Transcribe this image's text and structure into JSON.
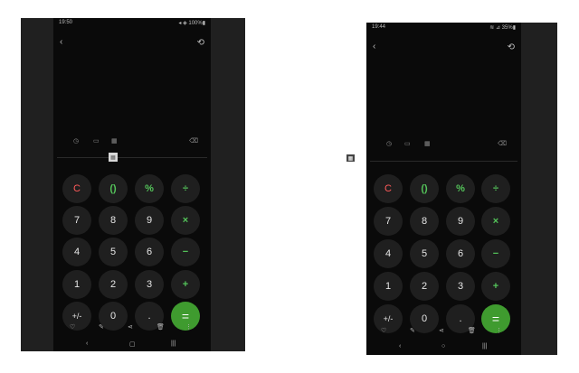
{
  "left_device": {
    "status": {
      "time": "19:50",
      "system": "◂ ◈ 100%▮"
    },
    "toolbar": {
      "back_icon": "‹",
      "rotate_icon": "⟲"
    },
    "tools": {
      "history_icon": "◷",
      "ruler_icon": "▭",
      "calc_icon": "▦",
      "backspace_icon": "⌫"
    },
    "handle_icon": "▦",
    "keys": {
      "clear": "C",
      "parens": "()",
      "percent": "%",
      "divide": "÷",
      "seven": "7",
      "eight": "8",
      "nine": "9",
      "multiply": "×",
      "four": "4",
      "five": "5",
      "six": "6",
      "minus": "−",
      "one": "1",
      "two": "2",
      "three": "3",
      "plus": "+",
      "plusminus": "+/-",
      "zero": "0",
      "dot": ".",
      "equals": "="
    },
    "bottom_bar": {
      "heart_icon": "♡",
      "edit_icon": "✎",
      "share_icon": "⋖",
      "trash_icon": "🗑",
      "more_icon": "⋮"
    },
    "navbar": {
      "back": "‹",
      "home": "▢",
      "recents": "|||"
    }
  },
  "right_device": {
    "status": {
      "time": "19:44",
      "system": "≋ ⊿ 35%▮"
    },
    "toolbar": {
      "back_icon": "‹",
      "rotate_icon": "⟲"
    },
    "tools": {
      "history_icon": "◷",
      "ruler_icon": "▭",
      "calc_icon": "▦",
      "backspace_icon": "⌫"
    },
    "side_icon": "▦",
    "keys": {
      "clear": "C",
      "parens": "()",
      "percent": "%",
      "divide": "÷",
      "seven": "7",
      "eight": "8",
      "nine": "9",
      "multiply": "×",
      "four": "4",
      "five": "5",
      "six": "6",
      "minus": "−",
      "one": "1",
      "two": "2",
      "three": "3",
      "plus": "+",
      "plusminus": "+/-",
      "zero": "0",
      "dot": ".",
      "equals": "="
    },
    "bottom_bar": {
      "heart_icon": "♡",
      "edit_icon": "✎",
      "share_icon": "⋖",
      "trash_icon": "🗑",
      "more_icon": "⋮"
    },
    "navbar": {
      "back": "‹",
      "home": "○",
      "recents": "|||"
    }
  },
  "colors": {
    "background": "#ffffff",
    "key": "#1f1f1f",
    "accent_green": "#54c45a",
    "clear_red": "#ff5a5a",
    "equals": "#3f9b2f"
  }
}
